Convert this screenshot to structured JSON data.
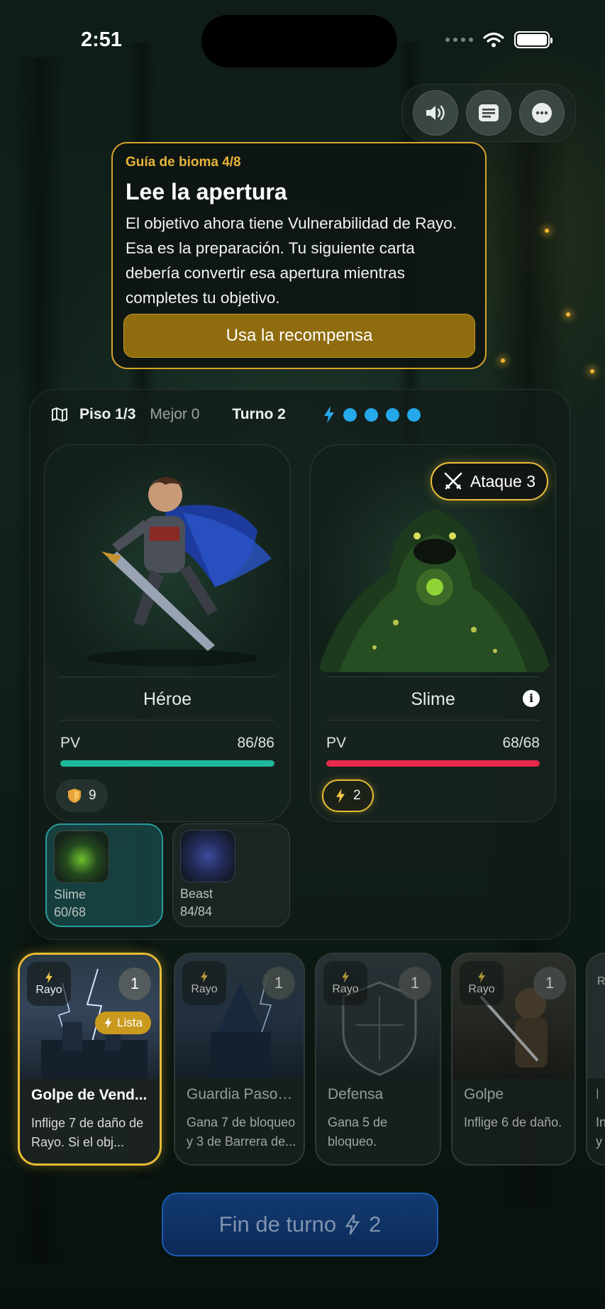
{
  "status_bar": {
    "time": "2:51"
  },
  "guide": {
    "tag": "Guía de bioma 4/8",
    "title": "Lee la apertura",
    "body": "El objetivo ahora tiene Vulnerabilidad de Rayo. Esa es la preparación. Tu siguiente carta debería convertir esa apertura mientras completes tu objetivo.",
    "button": "Usa la recompensa"
  },
  "battle": {
    "floor": "Piso 1/3",
    "best": "Mejor 0",
    "turn": "Turno 2",
    "energy_pips": 4,
    "hero": {
      "name": "Héroe",
      "hp_label": "PV",
      "hp_text": "86/86",
      "hp_fraction": 1.0,
      "hp_color": "#1fb89a",
      "block": "9"
    },
    "enemy": {
      "name": "Slime",
      "hp_label": "PV",
      "hp_text": "68/68",
      "hp_fraction": 1.0,
      "hp_color": "#e8294a",
      "intent": "Ataque 3",
      "energy_status": "2"
    }
  },
  "enemy_tabs": [
    {
      "name": "Slime",
      "hp": "60/68"
    },
    {
      "name": "Beast",
      "hp": "84/84"
    }
  ],
  "hand": [
    {
      "type": "Rayo",
      "cost": "1",
      "badge": "Lista",
      "title": "Golpe de Vend...",
      "desc": "Inflige 7 de daño de Rayo. Si el obj..."
    },
    {
      "type": "Rayo",
      "cost": "1",
      "title": "Guardia Paso d...",
      "desc": "Gana 7 de bloqueo y 3 de Barrera de..."
    },
    {
      "type": "Rayo",
      "cost": "1",
      "title": "Defensa",
      "desc": "Gana 5 de bloqueo."
    },
    {
      "type": "Rayo",
      "cost": "1",
      "title": "Golpe",
      "desc": "Inflige 6 de daño."
    },
    {
      "type": "R",
      "cost": "",
      "title": "H",
      "desc": "In y"
    }
  ],
  "end_turn": {
    "label": "Fin de turno",
    "energy": "2"
  },
  "colors": {
    "accent_gold": "#e6b43a",
    "energy_blue": "#25a9ea"
  }
}
